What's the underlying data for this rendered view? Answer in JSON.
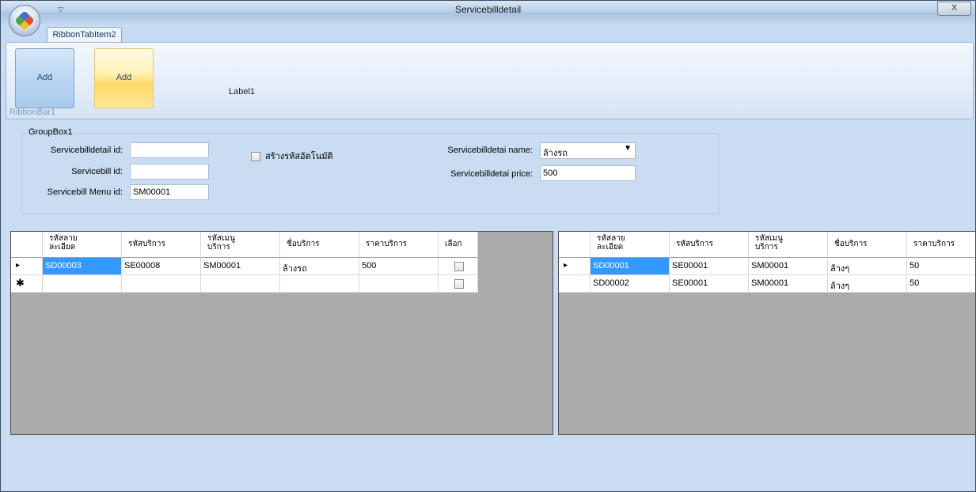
{
  "window": {
    "title": "Servicebilldetail",
    "close_glyph": "X"
  },
  "ribbon": {
    "tab_label": "RibbonTabItem2",
    "button1_label": "Add",
    "button2_label": "Add",
    "group_label": "RibbonBar1",
    "label1": "Label1"
  },
  "groupbox": {
    "title": "GroupBox1",
    "detail_id_label": "Servicebilldetail id:",
    "detail_id_value": "",
    "bill_id_label": "Servicebill id:",
    "bill_id_value": "",
    "menu_id_label": "Servicebill Menu id:",
    "menu_id_value": "SM00001",
    "auto_code_label": "สร้างรหัสอัตโนมัติ",
    "name_label": "Servicebilldetai name:",
    "name_value": "ล้างรถ",
    "price_label": "Servicebilldetai price:",
    "price_value": "500"
  },
  "left_grid": {
    "columns": [
      "รหัสลาย\nละเอียด",
      "รหัสบริการ",
      "รหัสเมนู\nบริการ",
      "ชื่อบริการ",
      "ราคาบริการ",
      "เลือก"
    ],
    "rows": [
      {
        "marker": "▸",
        "cells": [
          "SD00003",
          "SE00008",
          "SM00001",
          "ล้างรถ",
          "500"
        ]
      },
      {
        "marker": "✱",
        "cells": [
          "",
          "",
          "",
          "",
          ""
        ]
      }
    ]
  },
  "right_grid": {
    "columns": [
      "รหัสลาย\nละเอียด",
      "รหัสบริการ",
      "รหัสเมนู\nบริการ",
      "ชื่อบริการ",
      "ราคาบริการ"
    ],
    "rows": [
      {
        "marker": "▸",
        "cells": [
          "SD00001",
          "SE00001",
          "SM00001",
          "ล้างๆ",
          "50"
        ]
      },
      {
        "marker": "",
        "cells": [
          "SD00002",
          "SE00001",
          "SM00001",
          "ล้างๆ",
          "50"
        ]
      }
    ]
  },
  "colors": {
    "selection": "#3399ff",
    "grid_bg": "#ababab",
    "window_bg": "#c9dcf1"
  }
}
